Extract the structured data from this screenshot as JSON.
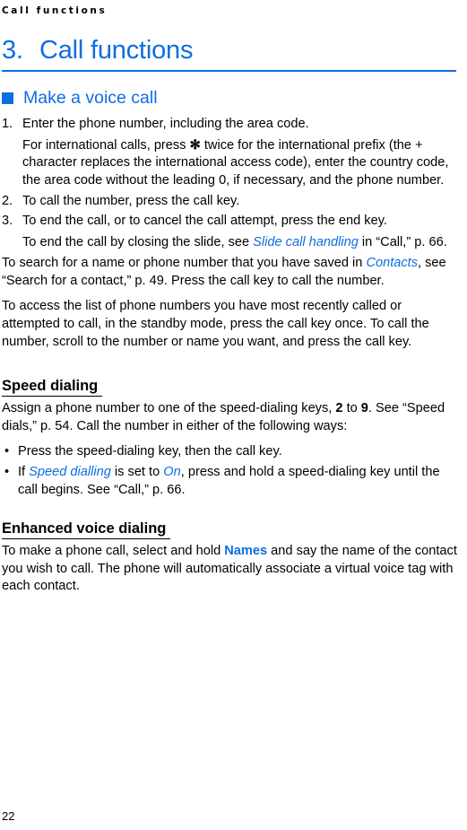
{
  "colors": {
    "accent": "#0d6ee0",
    "text": "#000000",
    "background": "#ffffff"
  },
  "running_header": "Call functions",
  "chapter": {
    "number": "3.",
    "title": "Call functions"
  },
  "section": {
    "bullet_icon": "square-bullet-icon",
    "title": "Make a voice call"
  },
  "steps": [
    {
      "number": "1.",
      "text": "Enter the phone number, including the area code.",
      "continuation": {
        "part1": "For international calls, press ",
        "asterisk": "✻",
        "part2": " twice for the international prefix (the + character replaces the international access code), enter the country code, the area code without the leading 0, if necessary, and the phone number."
      }
    },
    {
      "number": "2.",
      "text": "To call the number, press the call key."
    },
    {
      "number": "3.",
      "text": "To end the call, or to cancel the call attempt, press the end key.",
      "continuation": {
        "part1": "To end the call by closing the slide, see ",
        "xref": "Slide call handling",
        "part2": " in “Call,” p. 66."
      }
    }
  ],
  "paragraphs": {
    "search": {
      "part1": "To search for a name or phone number that you have saved in ",
      "xref": "Contacts",
      "part2": ", see “Search for a contact,” p. 49. Press the call key to call the number."
    },
    "recent": "To access the list of phone numbers you have most recently called or attempted to call, in the standby mode, press the call key once. To call the number, scroll to the number or name you want, and press the call key."
  },
  "speed_dialing": {
    "heading": "Speed dialing",
    "intro": {
      "part1": "Assign a phone number to one of the speed-dialing keys, ",
      "bold1": "2",
      "part2": " to ",
      "bold2": "9",
      "part3": ". See “Speed dials,” p. 54. Call the number in either of the following ways:"
    },
    "bullet_glyph": "•",
    "bullets": [
      {
        "text": "Press the speed-dialing key, then the call key."
      },
      {
        "part1": "If ",
        "xref1": "Speed dialling",
        "part2": " is set to ",
        "xref2": "On",
        "part3": ", press and hold a speed-dialing key until the call begins. See “Call,” p. 66."
      }
    ]
  },
  "enhanced_voice_dialing": {
    "heading": "Enhanced voice dialing",
    "body": {
      "part1": "To make a phone call, select and hold ",
      "uiterm": "Names",
      "part2": " and say the name of the contact you wish to call. The phone will automatically associate a virtual voice tag with each contact."
    }
  },
  "footer": {
    "page_number": "22"
  }
}
